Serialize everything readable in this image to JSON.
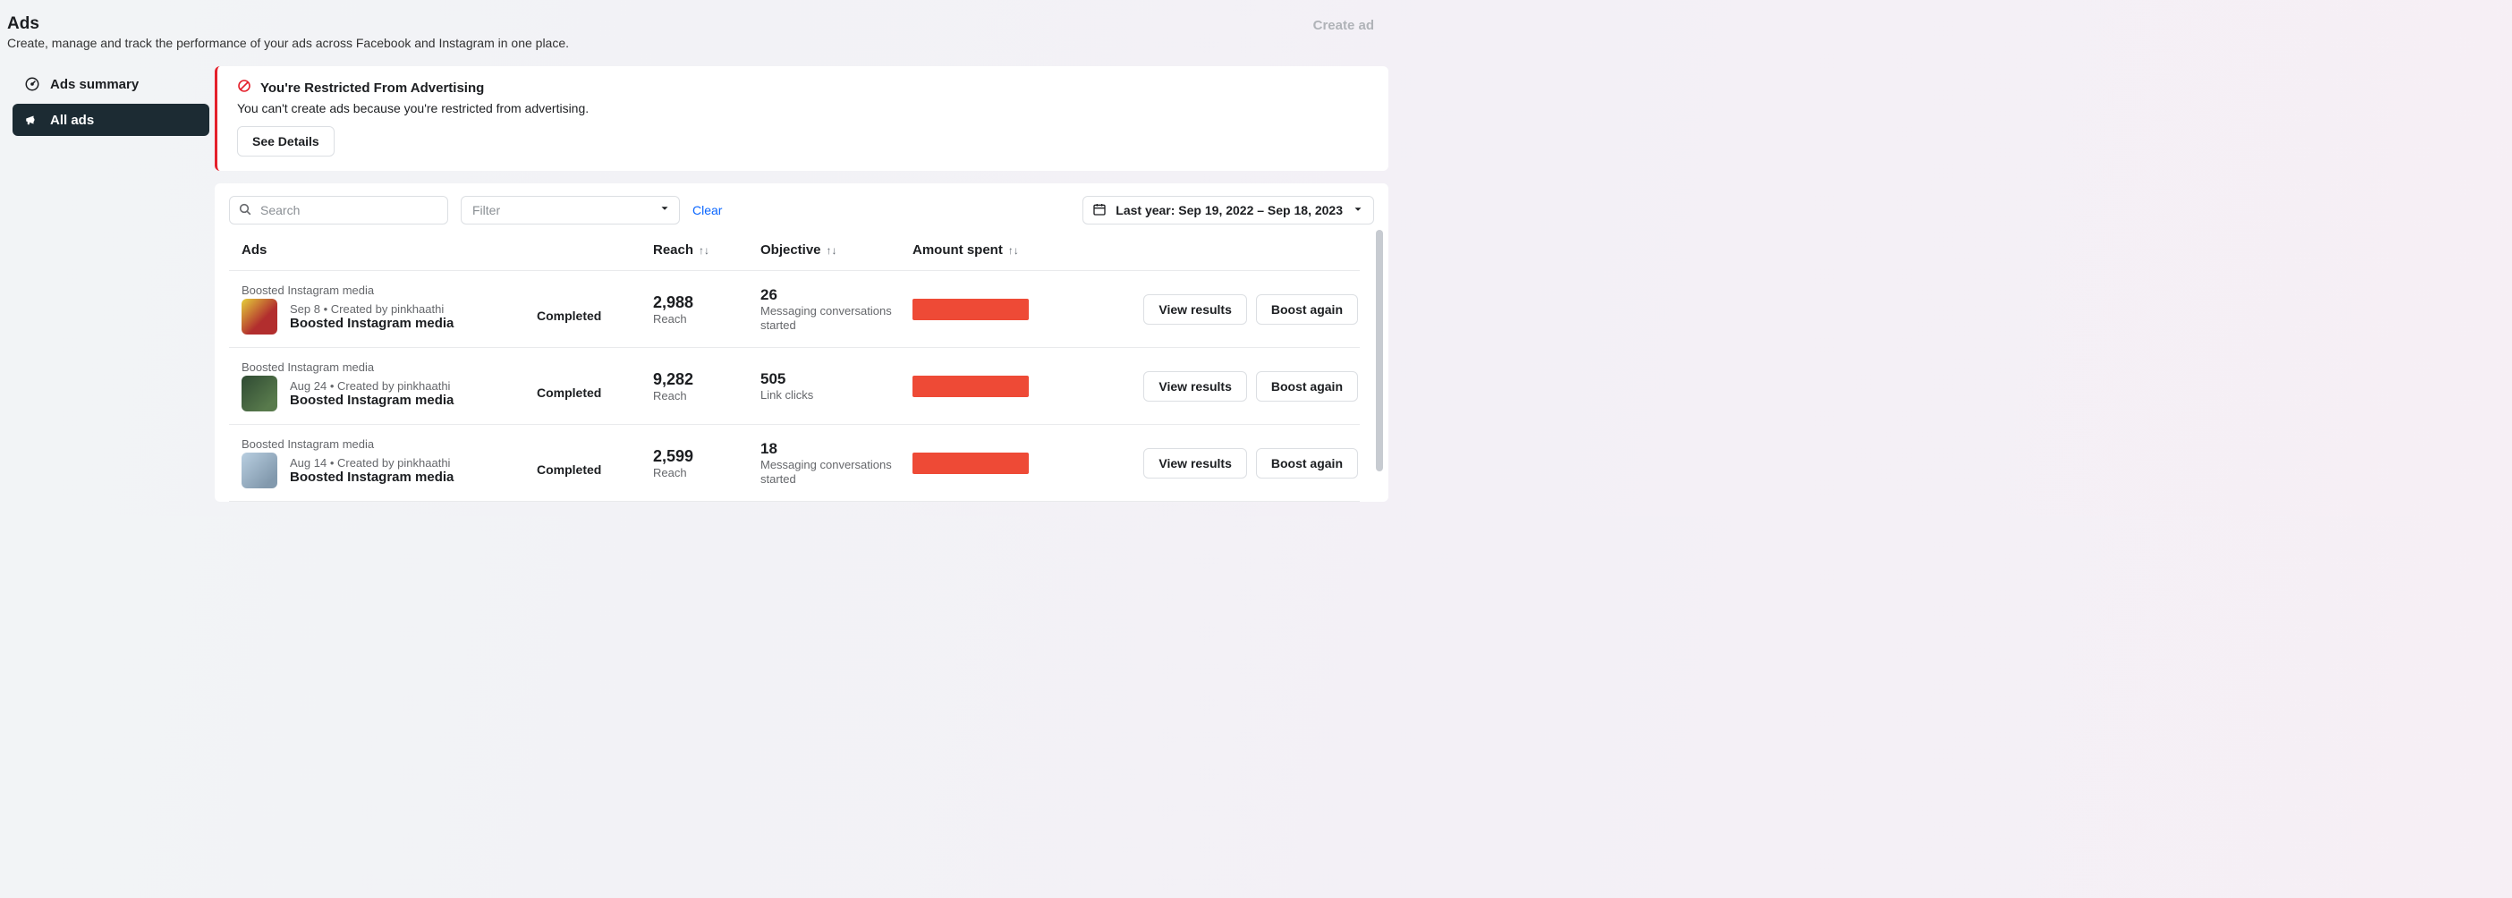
{
  "header": {
    "title": "Ads",
    "subtitle": "Create, manage and track the performance of your ads across Facebook and Instagram in one place.",
    "create_ad_label": "Create ad"
  },
  "sidebar": {
    "items": [
      {
        "label": "Ads summary"
      },
      {
        "label": "All ads"
      }
    ]
  },
  "notice": {
    "title": "You're Restricted From Advertising",
    "body": "You can't create ads because you're restricted from advertising.",
    "see_details_label": "See Details"
  },
  "toolbar": {
    "search_placeholder": "Search",
    "filter_label": "Filter",
    "clear_label": "Clear",
    "date_range_label": "Last year: Sep 19, 2022 – Sep 18, 2023"
  },
  "table": {
    "headers": {
      "ads": "Ads",
      "reach": "Reach",
      "objective": "Objective",
      "amount": "Amount spent"
    },
    "reach_sub_label": "Reach",
    "rows": [
      {
        "group_label": "Boosted Instagram media",
        "meta": "Sep 8  •  Created by pinkhaathi",
        "title": "Boosted Instagram media",
        "status": "Completed",
        "reach_value": "2,988",
        "objective_value": "26",
        "objective_sub": "Messaging conversations started"
      },
      {
        "group_label": "Boosted Instagram media",
        "meta": "Aug 24  •  Created by pinkhaathi",
        "title": "Boosted Instagram media",
        "status": "Completed",
        "reach_value": "9,282",
        "objective_value": "505",
        "objective_sub": "Link clicks"
      },
      {
        "group_label": "Boosted Instagram media",
        "meta": "Aug 14  •  Created by pinkhaathi",
        "title": "Boosted Instagram media",
        "status": "Completed",
        "reach_value": "2,599",
        "objective_value": "18",
        "objective_sub": "Messaging conversations started"
      }
    ],
    "actions": {
      "view_results_label": "View results",
      "boost_again_label": "Boost again"
    }
  }
}
